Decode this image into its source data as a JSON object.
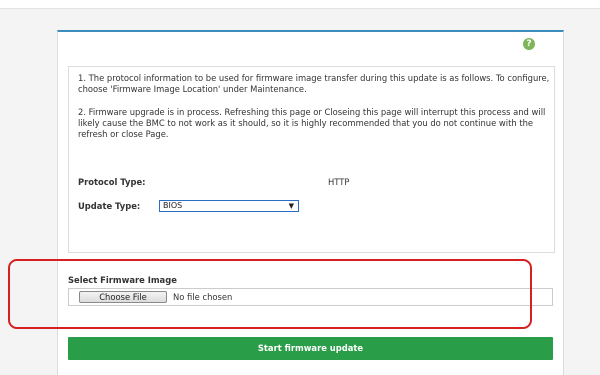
{
  "info": {
    "paragraph1": "1. The protocol information to be used for firmware image transfer during this update is as follows. To configure, choose 'Firmware Image Location' under Maintenance.",
    "paragraph2": "2. Firmware upgrade is in process. Refreshing this page or Closeing this page will interrupt this process and will likely cause the BMC to not work as it should, so it is highly recommended that you do not continue with the refresh or close Page."
  },
  "protocol": {
    "label": "Protocol Type:",
    "value": "HTTP"
  },
  "update_type": {
    "label": "Update Type:",
    "selected": "BIOS"
  },
  "firmware": {
    "title": "Select Firmware Image",
    "choose_label": "Choose File",
    "status": "No file chosen"
  },
  "actions": {
    "start_label": "Start firmware update"
  },
  "icons": {
    "help": "help-icon",
    "dropdown": "chevron-down-icon"
  },
  "colors": {
    "accent": "#3c8dbc",
    "success": "#2a9d48",
    "highlight": "#d62020",
    "help": "#7fb55a"
  }
}
